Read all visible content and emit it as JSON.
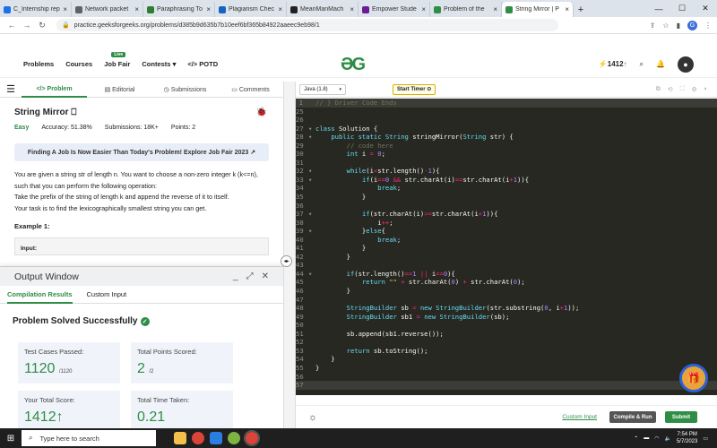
{
  "browser": {
    "tabs": [
      {
        "title": "C_Internship rep",
        "color": "#1a73e8"
      },
      {
        "title": "Network packet",
        "color": "#5f6368"
      },
      {
        "title": "Paraphrasing To",
        "color": "#2e7d32"
      },
      {
        "title": "Plagiarism Chec",
        "color": "#1565c0"
      },
      {
        "title": "MeanManMach",
        "color": "#222222"
      },
      {
        "title": "Empower Stude",
        "color": "#6a1b9a"
      },
      {
        "title": "Problem of the",
        "color": "#2f8d46"
      },
      {
        "title": "String Mirror | P",
        "color": "#2f8d46"
      }
    ],
    "url": "practice.geeksforgeeks.org/problems/d385b9d635b7b10eef6bf365b84922aaeec9eb98/1",
    "avatar": "G"
  },
  "nav": {
    "items": [
      "Problems",
      "Courses",
      "Job Fair",
      "Contests",
      "POTD"
    ],
    "live_badge": "Live",
    "logo": "ᘏᘐ",
    "streak": "1412",
    "avatar": "?"
  },
  "left_tabs": [
    "Problem",
    "Editorial",
    "Submissions",
    "Comments"
  ],
  "problem": {
    "title": "String Mirror",
    "difficulty": "Easy",
    "accuracy": "Accuracy: 51.38%",
    "submissions": "Submissions: 18K+",
    "points": "Points: 2",
    "banner": "Finding A Job Is Now Easier Than Today's Problem! Explore Job Fair 2023",
    "desc1": "You are given a string str of length n. You want to choose a non-zero integer k (k<=n), such that you can perform the following operation:",
    "desc2": "Take the prefix of the string of length k and append the reverse of it to itself.",
    "desc3": "Your task is to find the lexicographically smallest string you can get.",
    "example": "Example 1:",
    "input_label": "Input:"
  },
  "output_window": {
    "title": "Output Window",
    "tabs": [
      "Compilation Results",
      "Custom Input"
    ],
    "status": "Problem Solved Successfully",
    "cards": [
      {
        "label": "Test Cases Passed:",
        "value": "1120",
        "sub": "/1120"
      },
      {
        "label": "Total Points Scored:",
        "value": "2",
        "sub": "/2"
      },
      {
        "label": "Your Total Score:",
        "value": "1412",
        "sub": ""
      },
      {
        "label": "Total Time Taken:",
        "value": "0.21",
        "sub": ""
      }
    ]
  },
  "editor": {
    "language": "Java (1.8)",
    "timer": "Start Timer",
    "lines": [
      {
        "n": "1",
        "html": "<span class='cm'>// } Driver Code Ends</span>",
        "hl": true
      },
      {
        "n": "25",
        "html": ""
      },
      {
        "n": "26",
        "html": ""
      },
      {
        "n": "27",
        "html": "<span class='kw'>class</span> Solution {",
        "f": true
      },
      {
        "n": "28",
        "html": "    <span class='kw'>public static</span> <span class='ty'>String</span> stringMirror(<span class='ty'>String</span> str) {",
        "f": true
      },
      {
        "n": "29",
        "html": "        <span class='cm'>// code here</span>"
      },
      {
        "n": "30",
        "html": "        <span class='ty'>int</span> i <span class='op'>=</span> <span class='nm'>0</span>;"
      },
      {
        "n": "31",
        "html": ""
      },
      {
        "n": "32",
        "html": "        <span class='kw'>while</span>(i<span class='op'>&lt;</span>str.length()<span class='op'>-</span><span class='nm'>1</span>){",
        "f": true
      },
      {
        "n": "33",
        "html": "            <span class='kw'>if</span>(i<span class='op'>==</span><span class='nm'>0</span> <span class='op'>&amp;&amp;</span> str.charAt(i)<span class='op'>==</span>str.charAt(i<span class='op'>+</span><span class='nm'>1</span>)){",
        "f": true
      },
      {
        "n": "34",
        "html": "                <span class='kw'>break</span>;"
      },
      {
        "n": "35",
        "html": "            }"
      },
      {
        "n": "36",
        "html": ""
      },
      {
        "n": "37",
        "html": "            <span class='kw'>if</span>(str.charAt(i)<span class='op'>&gt;=</span>str.charAt(i<span class='op'>+</span><span class='nm'>1</span>)){",
        "f": true
      },
      {
        "n": "38",
        "html": "                i<span class='op'>++</span>;"
      },
      {
        "n": "39",
        "html": "            }<span class='kw'>else</span>{",
        "f": true
      },
      {
        "n": "40",
        "html": "                <span class='kw'>break</span>;"
      },
      {
        "n": "41",
        "html": "            }"
      },
      {
        "n": "42",
        "html": "        }"
      },
      {
        "n": "43",
        "html": ""
      },
      {
        "n": "44",
        "html": "        <span class='kw'>if</span>(str.length()<span class='op'>==</span><span class='nm'>1</span> <span class='op'>||</span> i<span class='op'>==</span><span class='nm'>0</span>){",
        "f": true
      },
      {
        "n": "45",
        "html": "            <span class='kw'>return</span> <span class='st'>\"\"</span> <span class='op'>+</span> str.charAt(<span class='nm'>0</span>) <span class='op'>+</span> str.charAt(<span class='nm'>0</span>);"
      },
      {
        "n": "46",
        "html": "        }"
      },
      {
        "n": "47",
        "html": ""
      },
      {
        "n": "48",
        "html": "        <span class='ty'>StringBuilder</span> sb <span class='op'>=</span> <span class='kw'>new</span> <span class='ty'>StringBuilder</span>(str.substring(<span class='nm'>0</span>, i<span class='op'>+</span><span class='nm'>1</span>));"
      },
      {
        "n": "49",
        "html": "        <span class='ty'>StringBuilder</span> sb1 <span class='op'>=</span> <span class='kw'>new</span> <span class='ty'>StringBuilder</span>(sb);"
      },
      {
        "n": "50",
        "html": ""
      },
      {
        "n": "51",
        "html": "        sb.append(sb1.reverse());"
      },
      {
        "n": "52",
        "html": ""
      },
      {
        "n": "53",
        "html": "        <span class='kw'>return</span> sb.toString();"
      },
      {
        "n": "54",
        "html": "    }"
      },
      {
        "n": "55",
        "html": "}"
      },
      {
        "n": "56",
        "html": ""
      },
      {
        "n": "57",
        "html": "",
        "hl": true
      }
    ],
    "custom_input": "Custom Input",
    "compile_run": "Compile & Run",
    "submit": "Submit"
  },
  "taskbar": {
    "search": "Type here to search",
    "time": "7:54 PM",
    "date": "5/7/2023"
  },
  "colors": {
    "accent": "#2f8d46",
    "editor_bg": "#272822"
  }
}
